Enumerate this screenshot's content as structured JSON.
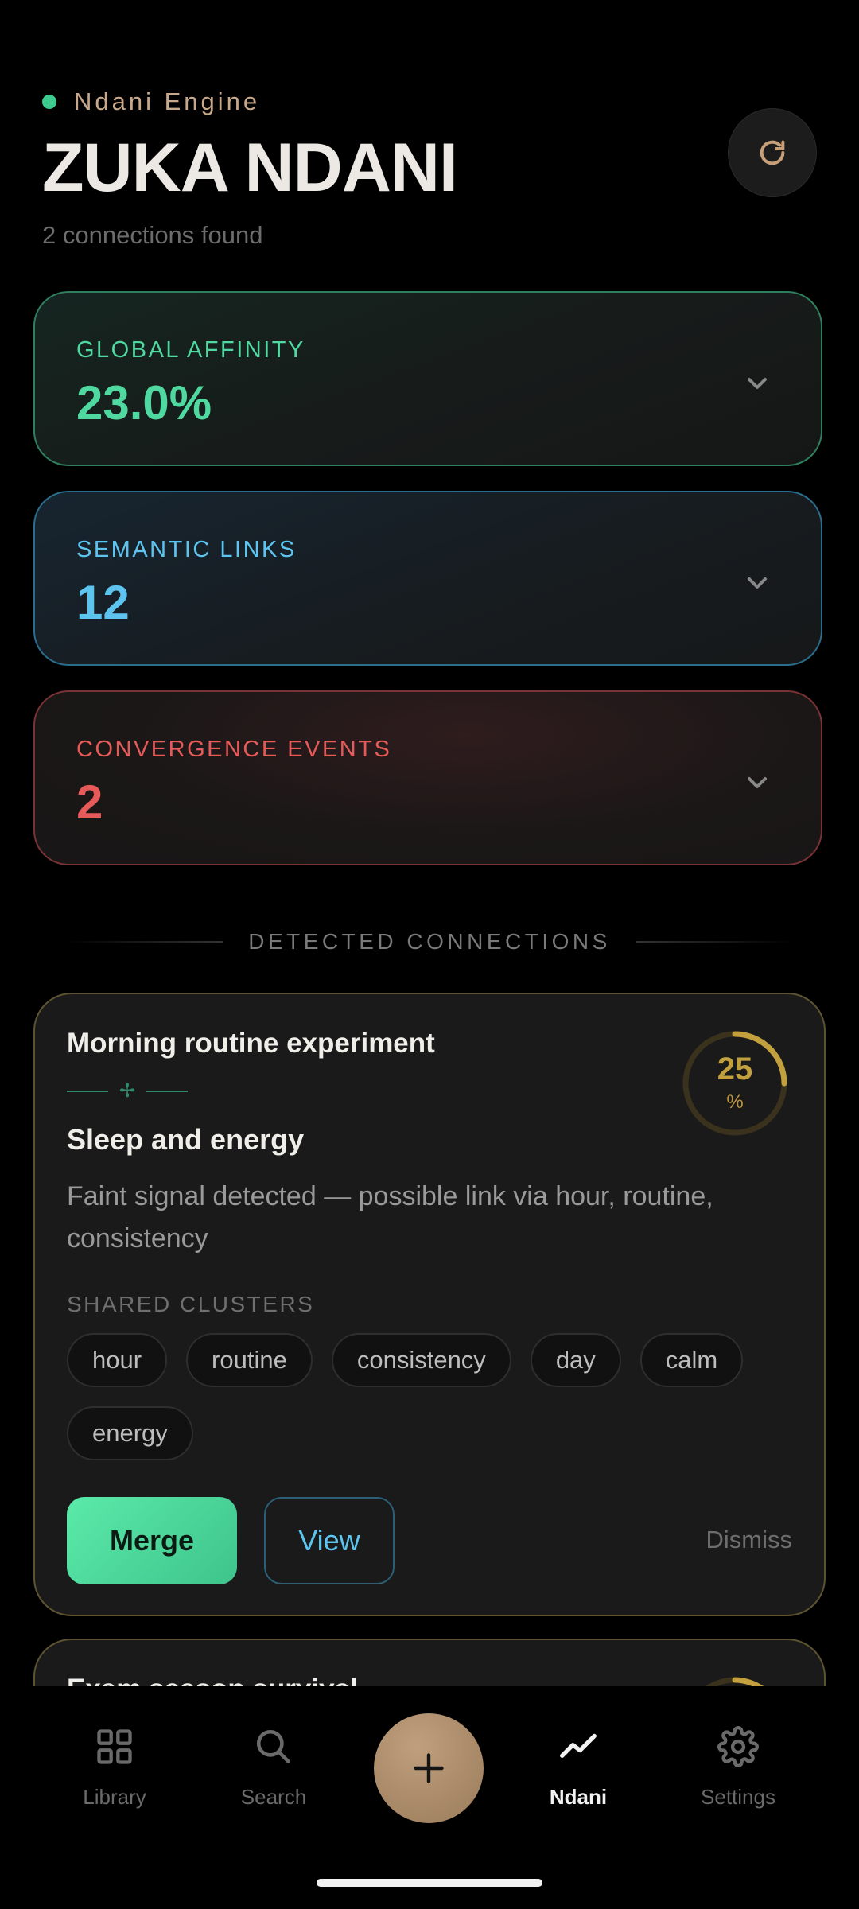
{
  "header": {
    "engine_name": "Ndani Engine",
    "title": "ZUKA NDANI",
    "subtitle": "2 connections found",
    "refresh_icon": "refresh-icon"
  },
  "stats": [
    {
      "label": "GLOBAL AFFINITY",
      "value": "23.0%",
      "color": "#4fd9a1"
    },
    {
      "label": "SEMANTIC LINKS",
      "value": "12",
      "color": "#5cc4ee"
    },
    {
      "label": "CONVERGENCE EVENTS",
      "value": "2",
      "color": "#e65a5a"
    }
  ],
  "section_label": "DETECTED CONNECTIONS",
  "connections": [
    {
      "title": "Morning routine experiment",
      "score": "25",
      "score_unit": "%",
      "score_fraction": 0.25,
      "linked_title": "Sleep and energy",
      "description": "Faint signal detected — possible link via hour, routine, consistency",
      "clusters_label": "SHARED CLUSTERS",
      "clusters": [
        "hour",
        "routine",
        "consistency",
        "day",
        "calm",
        "energy"
      ],
      "actions": {
        "merge": "Merge",
        "view": "View",
        "dismiss": "Dismiss"
      }
    },
    {
      "title": "Exam season survival"
    }
  ],
  "nav": {
    "items": [
      {
        "label": "Library",
        "icon": "grid-icon"
      },
      {
        "label": "Search",
        "icon": "search-icon"
      },
      {
        "label": "Ndani",
        "icon": "trend-icon",
        "active": true
      },
      {
        "label": "Settings",
        "icon": "gear-icon"
      }
    ],
    "fab_icon": "plus-icon"
  },
  "colors": {
    "accent_green": "#4fd9a1",
    "accent_blue": "#5cc4ee",
    "accent_red": "#e65a5a",
    "accent_gold": "#c2a03e",
    "background": "#000000"
  }
}
